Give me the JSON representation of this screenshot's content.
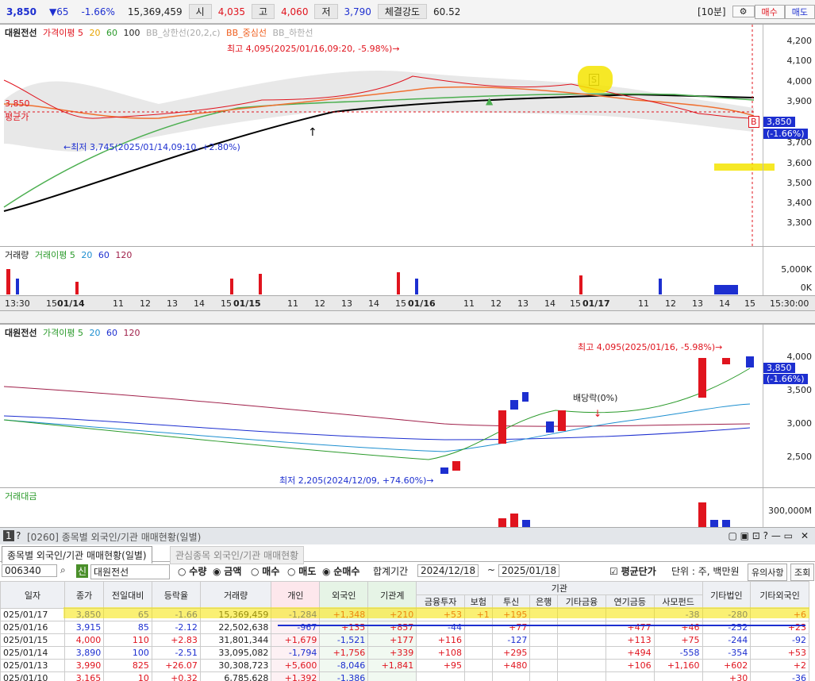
{
  "top": {
    "price": "3,850",
    "change": "▼65",
    "rate": "-1.66%",
    "volume": "15,369,459",
    "open_label": "시",
    "open": "4,035",
    "high_label": "고",
    "high": "4,060",
    "low_label": "저",
    "low": "3,790",
    "strength_label": "체결강도",
    "strength": "60.52",
    "period": "[10분]",
    "buy": "매수",
    "sell": "매도"
  },
  "chart1": {
    "legend": [
      "대원전선",
      "가격이평 5",
      "20",
      "60",
      "100",
      "BB_상한선(20,2,c)",
      "BB_중심선",
      "BB_하한선"
    ],
    "yticks": [
      "4,200",
      "4,100",
      "4,000",
      "3,900",
      "3,800",
      "3,700",
      "3,600",
      "3,500",
      "3,400",
      "3,300"
    ],
    "high_note": "최고 4,095(2025/01/16,09:20, -5.98%)→",
    "low_note": "←최저 3,745(2025/01/14,09:10, +2.80%)",
    "left_price": "3,850",
    "avg_label": "평균가",
    "cur_tag": "3,850",
    "cur_rate": "(-1.66%)",
    "s_marker": "S",
    "b_marker": "B"
  },
  "vol1": {
    "legend": [
      "거래량",
      "거래이평 5",
      "20",
      "60",
      "120"
    ],
    "yticks": [
      "5,000K",
      "0K"
    ]
  },
  "xaxis1": {
    "labels": [
      "13:30",
      "15",
      "01/14",
      "11",
      "12",
      "13",
      "14",
      "15",
      "01/15",
      "11",
      "12",
      "13",
      "14",
      "15",
      "01/16",
      "11",
      "12",
      "13",
      "14",
      "15",
      "01/17",
      "11",
      "12",
      "13",
      "14",
      "15",
      "15:30:00"
    ]
  },
  "chart2": {
    "legend": [
      "대원전선",
      "가격이평 5",
      "20",
      "60",
      "120"
    ],
    "yticks": [
      "4,000",
      "3,500",
      "3,000",
      "2,500"
    ],
    "high_note": "최고 4,095(2025/01/16, -5.98%)→",
    "low_note": "최저 2,205(2024/12/09, +74.60%)→",
    "div_note": "배당락(0%)",
    "cur_tag": "3,850",
    "cur_rate": "(-1.66%)"
  },
  "vol2": {
    "legend": "거래대금",
    "ytick": "300,000M"
  },
  "panel": {
    "num": "1",
    "code_title": "[0260] 종목별 외국인/기관 매매현황(일별)",
    "tab1": "종목별 외국인/기관 매매현황(일별)",
    "tab2": "관심종목 외국인/기관 매매현황",
    "stock_code": "006340",
    "stock_tag": "신",
    "stock_name": "대원전선",
    "r_qty": "수량",
    "r_amt": "금액",
    "r_buy": "매수",
    "r_sell": "매도",
    "r_net": "순매수",
    "sum_label": "합계기간",
    "date_from": "2024/12/18",
    "tilde": "~",
    "date_to": "2025/01/18",
    "avg_label": "평균단가",
    "unit": "단위 : 주, 백만원",
    "notice": "유의사항",
    "query": "조회"
  },
  "table": {
    "headers": [
      "일자",
      "종가",
      "전일대비",
      "등락율",
      "거래량",
      "개인",
      "외국인",
      "기관계",
      "금융투자",
      "보험",
      "투신",
      "은행",
      "기타금융",
      "연기금등",
      "사모펀드",
      "기타법인",
      "기타외국인"
    ],
    "group": "기관",
    "rows": [
      [
        "025/01/17",
        "3,850",
        "65",
        "-1.66",
        "15,369,459",
        "-1,284",
        "+1,348",
        "+210",
        "+53",
        "+1",
        "+195",
        "",
        "",
        "",
        "-38",
        "-280",
        "+6"
      ],
      [
        "025/01/16",
        "3,915",
        "85",
        "-2.12",
        "22,502,638",
        "-967",
        "+135",
        "+857",
        "-44",
        "",
        "+77",
        "",
        "",
        "+477",
        "+46",
        "-252",
        "+23"
      ],
      [
        "025/01/15",
        "4,000",
        "110",
        "+2.83",
        "31,801,344",
        "+1,679",
        "-1,521",
        "+177",
        "+116",
        "",
        "-127",
        "",
        "",
        "+113",
        "+75",
        "-244",
        "-92"
      ],
      [
        "025/01/14",
        "3,890",
        "100",
        "-2.51",
        "33,095,082",
        "-1,794",
        "+1,756",
        "+339",
        "+108",
        "",
        "+295",
        "",
        "",
        "+494",
        "-558",
        "-354",
        "+53"
      ],
      [
        "025/01/13",
        "3,990",
        "825",
        "+26.07",
        "30,308,723",
        "+5,600",
        "-8,046",
        "+1,841",
        "+95",
        "",
        "+480",
        "",
        "",
        "+106",
        "+1,160",
        "+602",
        "+2"
      ],
      [
        "025/01/10",
        "3,165",
        "10",
        "+0.32",
        "6,785,628",
        "+1,392",
        "-1,386",
        "",
        "",
        "",
        "",
        "",
        "",
        "",
        "",
        "+30",
        "-36"
      ]
    ]
  }
}
